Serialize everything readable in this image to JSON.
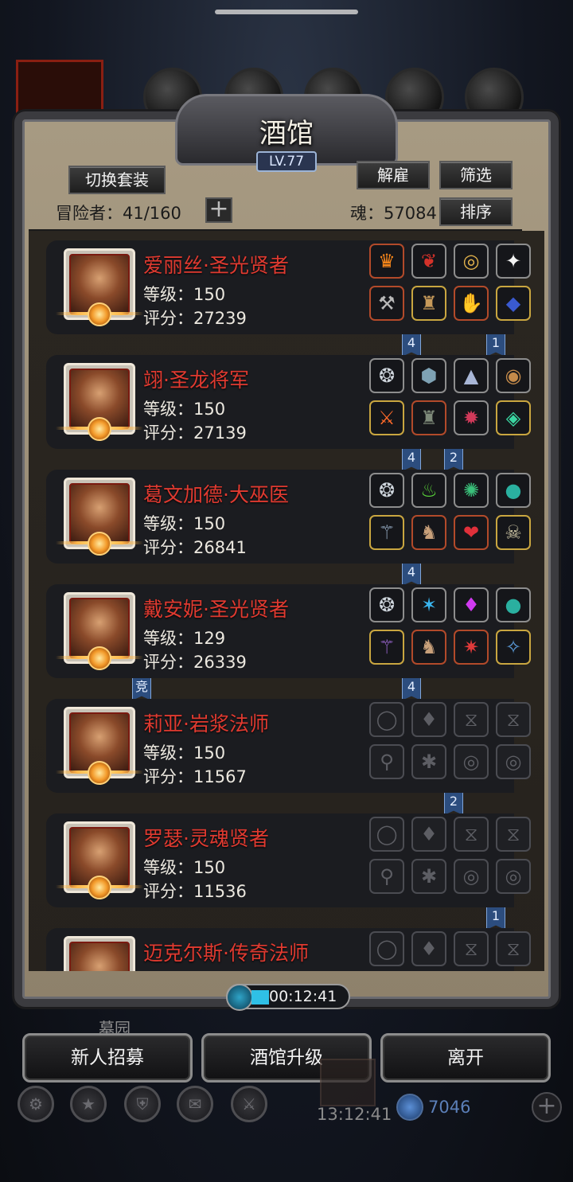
{
  "title": "酒馆",
  "level": "LV.77",
  "buttons": {
    "switch_outfit": "切换套装",
    "dismiss": "解雇",
    "filter": "筛选",
    "sort": "排序"
  },
  "adventurers": {
    "label": "冒险者：",
    "value": "41/160"
  },
  "soul": {
    "label": "魂：",
    "value": "57084"
  },
  "plus_icon": "plus-icon",
  "heroes": [
    {
      "name": "爱丽丝·圣光贤者",
      "level": "等级：150",
      "score": "评分：27239",
      "slots": [
        {
          "icon": "flame-crown",
          "glyph": "♛",
          "color": "#ff8a1a",
          "frame": "red"
        },
        {
          "icon": "red-armor",
          "glyph": "❦",
          "color": "#d4322a",
          "frame": "normal"
        },
        {
          "icon": "gold-amulet",
          "glyph": "◎",
          "color": "#e2b24c",
          "frame": "normal"
        },
        {
          "icon": "white-feather",
          "glyph": "✦",
          "color": "#f4f4f4",
          "frame": "normal"
        },
        {
          "icon": "hammer",
          "glyph": "⚒",
          "color": "#b9b9b9",
          "frame": "red"
        },
        {
          "icon": "cloak",
          "glyph": "♜",
          "color": "#c79a5a",
          "frame": "gold"
        },
        {
          "icon": "blue-gauntlet",
          "glyph": "✋",
          "color": "#5a8ad8",
          "frame": "red"
        },
        {
          "icon": "blue-gem-ring",
          "glyph": "◆",
          "color": "#3a5ad0",
          "frame": "gold"
        }
      ],
      "tags": [
        {
          "text": "4",
          "col": 1
        },
        {
          "text": "1",
          "col": 3
        }
      ]
    },
    {
      "name": "翊·圣龙将军",
      "level": "等级：150",
      "score": "评分：27139",
      "slots": [
        {
          "icon": "silver-circlet",
          "glyph": "❂",
          "color": "#cfd6dd",
          "frame": "normal"
        },
        {
          "icon": "stone-armor",
          "glyph": "⬢",
          "color": "#7ea2b4",
          "frame": "normal"
        },
        {
          "icon": "triangle-talisman",
          "glyph": "▲",
          "color": "#a8b6d6",
          "frame": "normal"
        },
        {
          "icon": "bronze-ring",
          "glyph": "◉",
          "color": "#c48a4a",
          "frame": "normal"
        },
        {
          "icon": "fire-sword",
          "glyph": "⚔",
          "color": "#ff6a2a",
          "frame": "gold"
        },
        {
          "icon": "dark-chestplate",
          "glyph": "♜",
          "color": "#7e8a7a",
          "frame": "red"
        },
        {
          "icon": "red-amulet",
          "glyph": "✹",
          "color": "#d23a5a",
          "frame": "normal"
        },
        {
          "icon": "green-ring",
          "glyph": "◈",
          "color": "#3ad6a2",
          "frame": "gold"
        }
      ],
      "tags": [
        {
          "text": "4",
          "col": 1
        },
        {
          "text": "2",
          "col": 2
        }
      ]
    },
    {
      "name": "葛文加德·大巫医",
      "level": "等级：150",
      "score": "评分：26841",
      "slots": [
        {
          "icon": "silver-circlet",
          "glyph": "❂",
          "color": "#cfd6dd",
          "frame": "normal"
        },
        {
          "icon": "green-flask",
          "glyph": "♨",
          "color": "#5ad63a",
          "frame": "normal"
        },
        {
          "icon": "green-lantern",
          "glyph": "✺",
          "color": "#3ac07a",
          "frame": "normal"
        },
        {
          "icon": "teal-stone",
          "glyph": "●",
          "color": "#2ab0a0",
          "frame": "normal"
        },
        {
          "icon": "staff",
          "glyph": "⚚",
          "color": "#9ab0c8",
          "frame": "gold"
        },
        {
          "icon": "horned-helm",
          "glyph": "♞",
          "color": "#c8a07a",
          "frame": "red"
        },
        {
          "icon": "red-pendant",
          "glyph": "❤",
          "color": "#e0303a",
          "frame": "red"
        },
        {
          "icon": "skull-pendant",
          "glyph": "☠",
          "color": "#c8c0a0",
          "frame": "gold"
        }
      ],
      "tags": [
        {
          "text": "4",
          "col": 1
        }
      ]
    },
    {
      "name": "戴安妮·圣光贤者",
      "level": "等级：129",
      "score": "评分：26339",
      "slots": [
        {
          "icon": "silver-circlet",
          "glyph": "❂",
          "color": "#cfd6dd",
          "frame": "normal"
        },
        {
          "icon": "blue-orb",
          "glyph": "✶",
          "color": "#3ab6f0",
          "frame": "normal"
        },
        {
          "icon": "purple-crystal",
          "glyph": "♦",
          "color": "#d03af0",
          "frame": "normal"
        },
        {
          "icon": "teal-stone",
          "glyph": "●",
          "color": "#2ab0a0",
          "frame": "normal"
        },
        {
          "icon": "purple-staff",
          "glyph": "⚚",
          "color": "#a06ad8",
          "frame": "gold"
        },
        {
          "icon": "horned-helm",
          "glyph": "♞",
          "color": "#c8a07a",
          "frame": "red"
        },
        {
          "icon": "demon-mask",
          "glyph": "✷",
          "color": "#e03a3a",
          "frame": "red"
        },
        {
          "icon": "blue-pendant",
          "glyph": "✧",
          "color": "#5a9ad8",
          "frame": "gold"
        }
      ],
      "tags": [
        {
          "text": "竞",
          "col": -1
        },
        {
          "text": "4",
          "col": 1
        }
      ]
    },
    {
      "name": "莉亚·岩浆法师",
      "level": "等级：150",
      "score": "评分：11567",
      "slots": [
        {
          "icon": "empty-circlet",
          "glyph": "◯",
          "color": "",
          "frame": "empty"
        },
        {
          "icon": "empty-armor",
          "glyph": "♦",
          "color": "",
          "frame": "empty"
        },
        {
          "icon": "empty-hourglass",
          "glyph": "⧖",
          "color": "",
          "frame": "empty"
        },
        {
          "icon": "empty-hourglass",
          "glyph": "⧖",
          "color": "",
          "frame": "empty"
        },
        {
          "icon": "empty-staff",
          "glyph": "⚲",
          "color": "",
          "frame": "empty"
        },
        {
          "icon": "empty-cloak",
          "glyph": "✱",
          "color": "",
          "frame": "empty"
        },
        {
          "icon": "empty-ring",
          "glyph": "◎",
          "color": "",
          "frame": "empty"
        },
        {
          "icon": "empty-ring",
          "glyph": "◎",
          "color": "",
          "frame": "empty"
        }
      ],
      "tags": [
        {
          "text": "2",
          "col": 2
        }
      ]
    },
    {
      "name": "罗瑟·灵魂贤者",
      "level": "等级：150",
      "score": "评分：11536",
      "slots": [
        {
          "icon": "empty-circlet",
          "glyph": "◯",
          "color": "",
          "frame": "empty"
        },
        {
          "icon": "empty-armor",
          "glyph": "♦",
          "color": "",
          "frame": "empty"
        },
        {
          "icon": "empty-hourglass",
          "glyph": "⧖",
          "color": "",
          "frame": "empty"
        },
        {
          "icon": "empty-hourglass",
          "glyph": "⧖",
          "color": "",
          "frame": "empty"
        },
        {
          "icon": "empty-staff",
          "glyph": "⚲",
          "color": "",
          "frame": "empty"
        },
        {
          "icon": "empty-cloak",
          "glyph": "✱",
          "color": "",
          "frame": "empty"
        },
        {
          "icon": "empty-ring",
          "glyph": "◎",
          "color": "",
          "frame": "empty"
        },
        {
          "icon": "empty-ring",
          "glyph": "◎",
          "color": "",
          "frame": "empty"
        }
      ],
      "tags": [
        {
          "text": "1",
          "col": 3
        }
      ]
    },
    {
      "name": "迈克尔斯·传奇法师",
      "level": "",
      "score": "",
      "slots": [
        {
          "icon": "empty-circlet",
          "glyph": "◯",
          "color": "",
          "frame": "empty"
        },
        {
          "icon": "empty-armor",
          "glyph": "♦",
          "color": "",
          "frame": "empty"
        },
        {
          "icon": "empty-hourglass",
          "glyph": "⧖",
          "color": "",
          "frame": "empty"
        },
        {
          "icon": "empty-hourglass",
          "glyph": "⧖",
          "color": "",
          "frame": "empty"
        }
      ],
      "tags": []
    }
  ],
  "timer": "00:12:41",
  "background_label": "墓园",
  "bottom_buttons": {
    "recruit": "新人招募",
    "upgrade": "酒馆升级",
    "leave": "离开"
  },
  "dock": {
    "time": "13:12:41",
    "gems": "7046"
  }
}
